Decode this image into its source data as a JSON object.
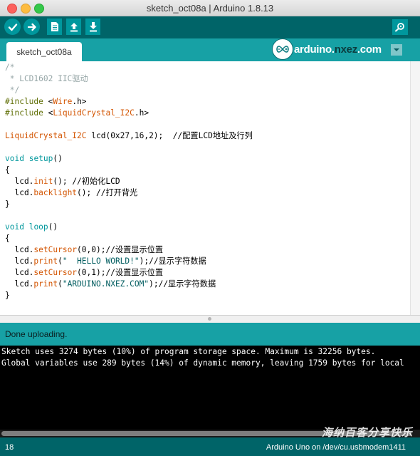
{
  "window": {
    "title": "sketch_oct08a | Arduino 1.8.13"
  },
  "toolbar": {
    "verify": "verify-icon",
    "upload": "upload-arrow-icon",
    "new": "new-file-icon",
    "open": "open-arrow-up-icon",
    "save": "save-arrow-down-icon",
    "serial_monitor": "magnifier-icon"
  },
  "tabs": [
    {
      "label": "sketch_oct08a"
    }
  ],
  "logo": {
    "prefix": "arduino.",
    "domain": "nxez",
    "suffix": ".com"
  },
  "editor": {
    "lines": [
      [
        {
          "t": "/*",
          "c": "com"
        }
      ],
      [
        {
          "t": " * LCD1602 IIC驱动",
          "c": "com"
        }
      ],
      [
        {
          "t": " */",
          "c": "com"
        }
      ],
      [
        {
          "t": "#include ",
          "c": "pp"
        },
        {
          "t": "<",
          "c": ""
        },
        {
          "t": "Wire",
          "c": "lib"
        },
        {
          "t": ".h>",
          "c": ""
        }
      ],
      [
        {
          "t": "#include ",
          "c": "pp"
        },
        {
          "t": "<",
          "c": ""
        },
        {
          "t": "LiquidCrystal_I2C",
          "c": "lib"
        },
        {
          "t": ".h>",
          "c": ""
        }
      ],
      [
        {
          "t": "",
          "c": ""
        }
      ],
      [
        {
          "t": "LiquidCrystal_I2C",
          "c": "lib"
        },
        {
          "t": " lcd(0x27,16,2);  ",
          "c": ""
        },
        {
          "t": "//配置LCD地址及行列",
          "c": ""
        }
      ],
      [
        {
          "t": "",
          "c": ""
        }
      ],
      [
        {
          "t": "void",
          "c": "kw"
        },
        {
          "t": " ",
          "c": ""
        },
        {
          "t": "setup",
          "c": "kw"
        },
        {
          "t": "()",
          "c": ""
        }
      ],
      [
        {
          "t": "{",
          "c": ""
        }
      ],
      [
        {
          "t": "  lcd.",
          "c": ""
        },
        {
          "t": "init",
          "c": "fn"
        },
        {
          "t": "(); //初始化LCD",
          "c": ""
        }
      ],
      [
        {
          "t": "  lcd.",
          "c": ""
        },
        {
          "t": "backlight",
          "c": "fn"
        },
        {
          "t": "(); //打开背光",
          "c": ""
        }
      ],
      [
        {
          "t": "}",
          "c": ""
        }
      ],
      [
        {
          "t": "",
          "c": ""
        }
      ],
      [
        {
          "t": "void",
          "c": "kw"
        },
        {
          "t": " ",
          "c": ""
        },
        {
          "t": "loop",
          "c": "kw"
        },
        {
          "t": "()",
          "c": ""
        }
      ],
      [
        {
          "t": "{",
          "c": ""
        }
      ],
      [
        {
          "t": "  lcd.",
          "c": ""
        },
        {
          "t": "setCursor",
          "c": "fn"
        },
        {
          "t": "(0,0);//设置显示位置",
          "c": ""
        }
      ],
      [
        {
          "t": "  lcd.",
          "c": ""
        },
        {
          "t": "print",
          "c": "fn"
        },
        {
          "t": "(",
          "c": ""
        },
        {
          "t": "\"  HELLO WORLD!\"",
          "c": "str"
        },
        {
          "t": ");//显示字符数据",
          "c": ""
        }
      ],
      [
        {
          "t": "  lcd.",
          "c": ""
        },
        {
          "t": "setCursor",
          "c": "fn"
        },
        {
          "t": "(0,1);//设置显示位置",
          "c": ""
        }
      ],
      [
        {
          "t": "  lcd.",
          "c": ""
        },
        {
          "t": "print",
          "c": "fn"
        },
        {
          "t": "(",
          "c": ""
        },
        {
          "t": "\"ARDUINO.NXEZ.COM\"",
          "c": "str"
        },
        {
          "t": ");//显示字符数据",
          "c": ""
        }
      ],
      [
        {
          "t": "}",
          "c": ""
        }
      ]
    ]
  },
  "status": {
    "message": "Done uploading."
  },
  "console": {
    "lines": [
      "Sketch uses 3274 bytes (10%) of program storage space. Maximum is 32256 bytes.",
      "Global variables use 289 bytes (14%) of dynamic memory, leaving 1759 bytes for local"
    ]
  },
  "bottom": {
    "line": "18",
    "board": "Arduino Uno on /dev/cu.usbmodem1411"
  },
  "watermark": "海纳百客分享快乐",
  "colors": {
    "toolbar": "#006468",
    "tabstrip": "#17a1a5",
    "button": "#00979d",
    "keyword": "#00979c",
    "function": "#d35400",
    "comment": "#95a5a6"
  }
}
